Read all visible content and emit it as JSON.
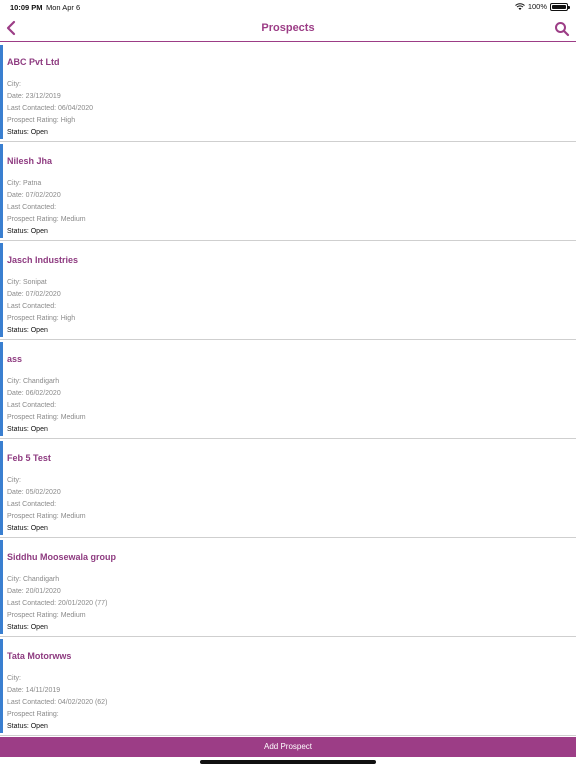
{
  "status_bar": {
    "time": "10:09 PM",
    "date": "Mon Apr 6",
    "battery": "100%",
    "battery_level": 1.0
  },
  "nav": {
    "title": "Prospects"
  },
  "prospects": [
    {
      "name": "ABC Pvt Ltd",
      "city": "City:",
      "date": "Date: 23/12/2019",
      "last_contacted": "Last Contacted: 06/04/2020",
      "rating": "Prospect Rating: High",
      "status": "Status: Open"
    },
    {
      "name": "Nilesh Jha",
      "city": "City: Patna",
      "date": "Date: 07/02/2020",
      "last_contacted": "Last Contacted:",
      "rating": "Prospect Rating: Medium",
      "status": "Status: Open"
    },
    {
      "name": "Jasch Industries",
      "city": "City: Sonipat",
      "date": "Date: 07/02/2020",
      "last_contacted": "Last Contacted:",
      "rating": "Prospect Rating: High",
      "status": "Status: Open"
    },
    {
      "name": "ass",
      "city": "City: Chandigarh",
      "date": "Date: 06/02/2020",
      "last_contacted": "Last Contacted:",
      "rating": "Prospect Rating: Medium",
      "status": "Status: Open"
    },
    {
      "name": "Feb 5 Test",
      "city": "City:",
      "date": "Date: 05/02/2020",
      "last_contacted": "Last Contacted:",
      "rating": "Prospect Rating: Medium",
      "status": "Status: Open"
    },
    {
      "name": "Siddhu Moosewala group",
      "city": "City: Chandigarh",
      "date": "Date: 20/01/2020",
      "last_contacted": "Last Contacted: 20/01/2020 (77)",
      "rating": "Prospect Rating: Medium",
      "status": "Status: Open"
    },
    {
      "name": "Tata Motorwws",
      "city": "City:",
      "date": "Date: 14/11/2019",
      "last_contacted": "Last Contacted: 04/02/2020 (62)",
      "rating": "Prospect Rating:",
      "status": "Status: Open"
    }
  ],
  "footer": {
    "add_label": "Add Prospect"
  },
  "colors": {
    "accent": "#9c3d86",
    "card_stripe": "#3a7fd0",
    "name": "#8e3b80"
  },
  "icons": {
    "back": "chevron-left-icon",
    "search": "search-icon",
    "wifi": "wifi-icon",
    "battery": "battery-icon"
  }
}
